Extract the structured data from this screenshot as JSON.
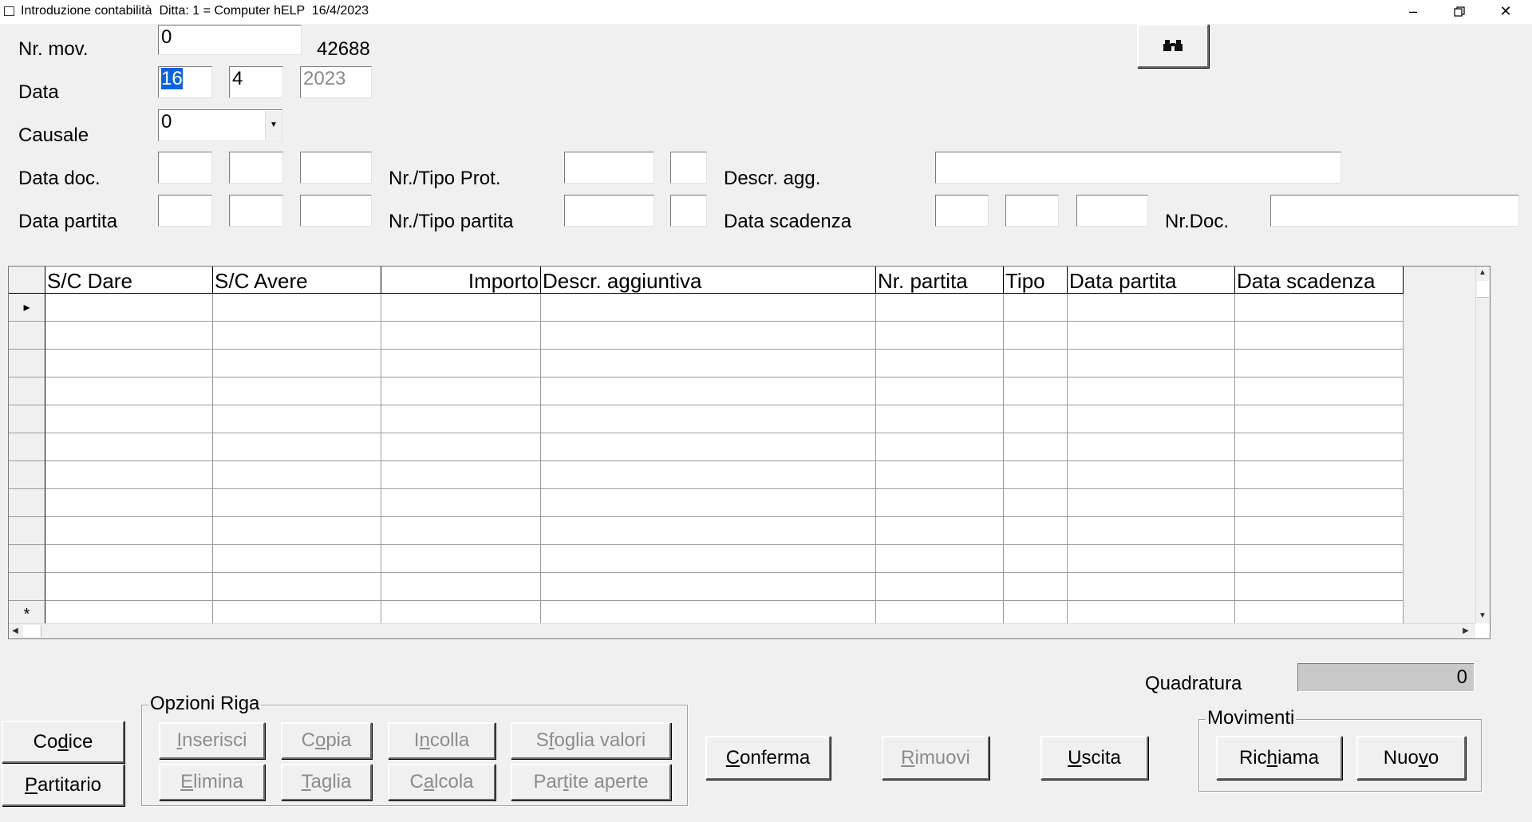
{
  "window": {
    "title": "Introduzione contabilità  Ditta: 1 = Computer hELP  16/4/2023",
    "minimize_icon": "minimize-icon",
    "restore_icon": "restore-icon",
    "close_icon": "close-icon"
  },
  "form": {
    "nr_mov": {
      "label": "Nr. mov.",
      "value": "0",
      "counter": "42688"
    },
    "data": {
      "label": "Data",
      "day": "16",
      "month": "4",
      "year": "2023"
    },
    "causale": {
      "label": "Causale",
      "value": "0"
    },
    "data_doc": {
      "label": "Data doc.",
      "day": "",
      "month": "",
      "year": ""
    },
    "nr_tipo_prot": {
      "label": "Nr./Tipo Prot.",
      "nr": "",
      "tipo": ""
    },
    "descr_agg": {
      "label": "Descr. agg.",
      "value": ""
    },
    "data_partita": {
      "label": "Data partita",
      "day": "",
      "month": "",
      "year": ""
    },
    "nr_tipo_partita": {
      "label": "Nr./Tipo partita",
      "nr": "",
      "tipo": ""
    },
    "data_scadenza": {
      "label": "Data scadenza",
      "day": "",
      "month": "",
      "year": ""
    },
    "nr_doc": {
      "label": "Nr.Doc.",
      "value": ""
    },
    "search_icon": "binoculars-icon"
  },
  "grid": {
    "columns": [
      "S/C Dare",
      "S/C Avere",
      "Importo",
      "Descr. aggiuntiva",
      "Nr. partita",
      "Tipo",
      "Data partita",
      "Data scadenza"
    ],
    "current_row_marker": "▸",
    "new_row_marker": "*"
  },
  "quadratura": {
    "label": "Quadratura",
    "value": "0"
  },
  "opzioni_riga": {
    "title": "Opzioni Riga",
    "buttons": [
      {
        "pre": "",
        "u": "I",
        "post": "nserisci"
      },
      {
        "pre": "C",
        "u": "o",
        "post": "pia"
      },
      {
        "pre": "I",
        "u": "n",
        "post": "colla"
      },
      {
        "pre": "S",
        "u": "f",
        "post": "oglia valori"
      },
      {
        "pre": "",
        "u": "E",
        "post": "limina"
      },
      {
        "pre": "",
        "u": "T",
        "post": "aglia"
      },
      {
        "pre": "C",
        "u": "a",
        "post": "lcola"
      },
      {
        "pre": "Par",
        "u": "t",
        "post": "ite aperte"
      }
    ]
  },
  "buttons": {
    "codice": {
      "pre": "Co",
      "u": "d",
      "post": "ice"
    },
    "partitario": {
      "pre": "",
      "u": "P",
      "post": "artitario"
    },
    "conferma": {
      "pre": "",
      "u": "C",
      "post": "onferma"
    },
    "rimuovi": {
      "pre": "",
      "u": "R",
      "post": "imuovi"
    },
    "uscita": {
      "pre": "",
      "u": "U",
      "post": "scita"
    }
  },
  "movimenti": {
    "title": "Movimenti",
    "richiama": {
      "pre": "Ric",
      "u": "h",
      "post": "iama"
    },
    "nuovo": {
      "pre": "Nuo",
      "u": "v",
      "post": "o"
    }
  }
}
